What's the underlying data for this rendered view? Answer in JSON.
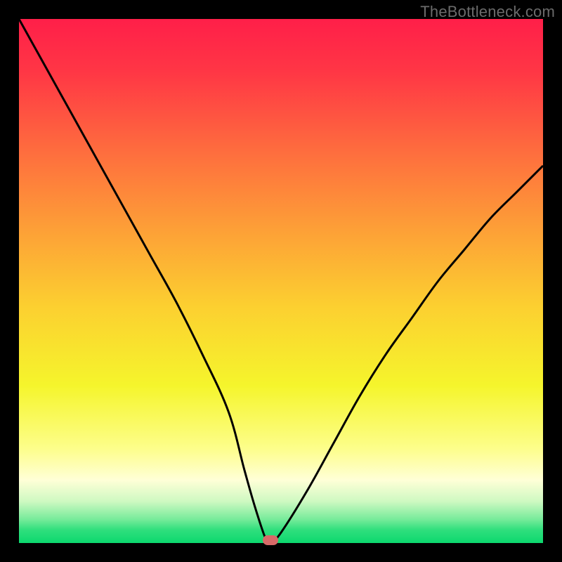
{
  "watermark": {
    "text": "TheBottleneck.com"
  },
  "chart_data": {
    "type": "line",
    "title": "",
    "xlabel": "",
    "ylabel": "",
    "xlim": [
      0,
      100
    ],
    "ylim": [
      0,
      100
    ],
    "grid": false,
    "legend": false,
    "series": [
      {
        "name": "bottleneck-curve",
        "x": [
          0,
          5,
          10,
          15,
          20,
          25,
          30,
          35,
          40,
          43,
          45,
          47,
          48,
          50,
          55,
          60,
          65,
          70,
          75,
          80,
          85,
          90,
          95,
          100
        ],
        "y": [
          100,
          91,
          82,
          73,
          64,
          55,
          46,
          36,
          25,
          14,
          7,
          1,
          0,
          2,
          10,
          19,
          28,
          36,
          43,
          50,
          56,
          62,
          67,
          72
        ]
      }
    ],
    "marker": {
      "x": 48,
      "y": 0.5,
      "color": "#d86a68"
    },
    "background_gradient": {
      "stops": [
        {
          "pos": 0.0,
          "color": "#ff1f49"
        },
        {
          "pos": 0.1,
          "color": "#ff3645"
        },
        {
          "pos": 0.25,
          "color": "#fe6c3e"
        },
        {
          "pos": 0.4,
          "color": "#fd9f37"
        },
        {
          "pos": 0.55,
          "color": "#fcd030"
        },
        {
          "pos": 0.7,
          "color": "#f5f52c"
        },
        {
          "pos": 0.82,
          "color": "#fdfe8b"
        },
        {
          "pos": 0.88,
          "color": "#ffffd7"
        },
        {
          "pos": 0.92,
          "color": "#cff9c2"
        },
        {
          "pos": 0.955,
          "color": "#76eb9a"
        },
        {
          "pos": 0.975,
          "color": "#2fdf7d"
        },
        {
          "pos": 1.0,
          "color": "#0cd86e"
        }
      ]
    }
  }
}
